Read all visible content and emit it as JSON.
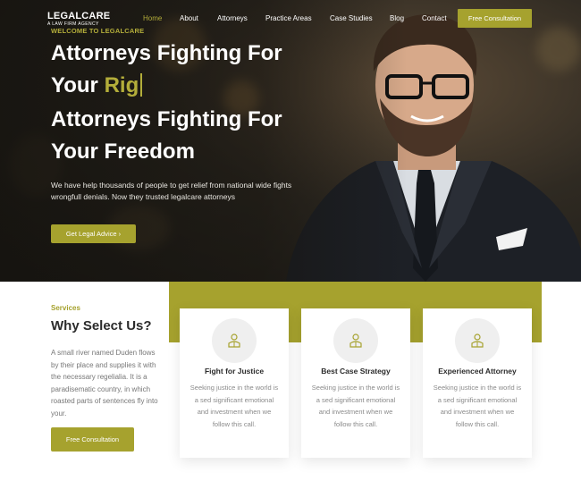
{
  "brand": {
    "name": "LEGALCARE",
    "tagline": "A LAW FIRM AGENCY"
  },
  "nav": {
    "items": [
      "Home",
      "About",
      "Attorneys",
      "Practice Areas",
      "Case Studies",
      "Blog",
      "Contact"
    ],
    "active": "Home",
    "cta": "Free Consultation"
  },
  "hero": {
    "welcome": "WELCOME TO LEGALCARE",
    "typing_line1": "Attorneys Fighting For",
    "typing_line2_prefix": "Your ",
    "typing_line2_accent": "Rig",
    "headline_line1": "Attorneys Fighting For",
    "headline_line2": "Your Freedom",
    "description": "We have help thousands of people to get relief from national wide fights wrongfull denials. Now they trusted legalcare attorneys",
    "button": "Get Legal Advice ›"
  },
  "services": {
    "label": "Services",
    "title": "Why Select Us?",
    "text": "A small river named Duden flows by their place and supplies it with the necessary regelialia. It is a paradisematic country, in which roasted parts of sentences fly into your.",
    "button": "Free Consultation",
    "cards": [
      {
        "icon": "lawyer-icon",
        "title": "Fight for Justice",
        "text": "Seeking justice in the world is a sed significant emotional and investment when we follow this call."
      },
      {
        "icon": "lawyer-icon",
        "title": "Best Case Strategy",
        "text": "Seeking justice in the world is a sed significant emotional and investment when we follow this call."
      },
      {
        "icon": "lawyer-icon",
        "title": "Experienced Attorney",
        "text": "Seeking justice in the world is a sed significant emotional and investment when we follow this call."
      }
    ]
  },
  "colors": {
    "accent": "#a6a22e",
    "accent_text": "#b3ad3a",
    "dark": "#2b2b2b"
  }
}
